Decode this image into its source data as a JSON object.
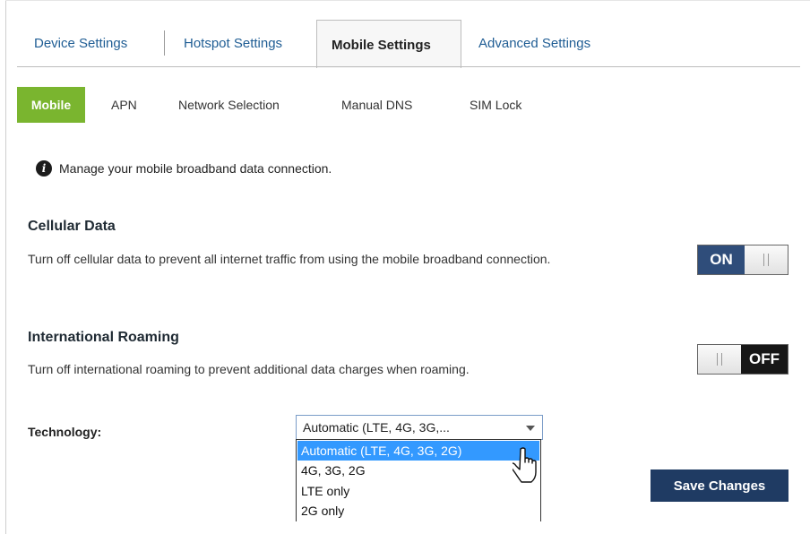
{
  "tabs": [
    {
      "label": "Device Settings"
    },
    {
      "label": "Hotspot Settings"
    },
    {
      "label": "Mobile Settings",
      "active": true
    },
    {
      "label": "Advanced Settings"
    }
  ],
  "subtabs": [
    {
      "label": "Mobile",
      "active": true
    },
    {
      "label": "APN"
    },
    {
      "label": "Network Selection"
    },
    {
      "label": "Manual DNS"
    },
    {
      "label": "SIM Lock"
    }
  ],
  "info": {
    "icon": "info-icon",
    "text": "Manage your mobile broadband data connection."
  },
  "cellular": {
    "title": "Cellular Data",
    "description": "Turn off cellular data to prevent all internet traffic from using the mobile broadband connection.",
    "toggle_label": "ON",
    "state": "on"
  },
  "roaming": {
    "title": "International Roaming",
    "description": "Turn off international roaming to prevent additional data charges when roaming.",
    "toggle_label": "OFF",
    "state": "off"
  },
  "technology": {
    "label": "Technology:",
    "selected": "Automatic (LTE, 4G, 3G,...",
    "options": [
      "Automatic (LTE, 4G, 3G, 2G)",
      "4G, 3G, 2G",
      "LTE only",
      "2G only"
    ],
    "highlighted_index": 0
  },
  "save_label": "Save Changes",
  "colors": {
    "accent_green": "#7ab52f",
    "toggle_on": "#2f4d7a",
    "toggle_off": "#171717",
    "save_button": "#1f3b63",
    "tab_link": "#1f5d94",
    "dropdown_highlight": "#3399ff"
  }
}
